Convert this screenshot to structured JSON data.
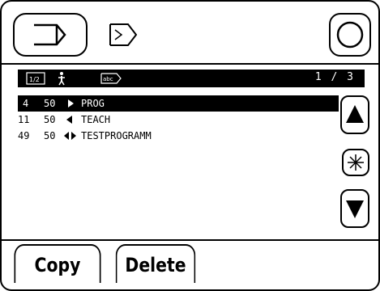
{
  "pager": {
    "current": "1",
    "separator": "/",
    "total": "3"
  },
  "programs": [
    {
      "num": "4",
      "size": "50",
      "dir_icon": "arrow-right-icon",
      "name": "PROG",
      "selected": true
    },
    {
      "num": "11",
      "size": "50",
      "dir_icon": "arrow-left-icon",
      "name": "TEACH",
      "selected": false
    },
    {
      "num": "49",
      "size": "50",
      "dir_icon": "arrow-both-icon",
      "name": "TESTPROGRAMM",
      "selected": false
    }
  ],
  "actions": {
    "copy_label": "Copy",
    "delete_label": "Delete"
  },
  "header_icons": [
    "program-number-icon",
    "person-icon",
    "abc-name-icon"
  ],
  "colors": {
    "background": "#ffffff",
    "foreground": "#000000"
  }
}
